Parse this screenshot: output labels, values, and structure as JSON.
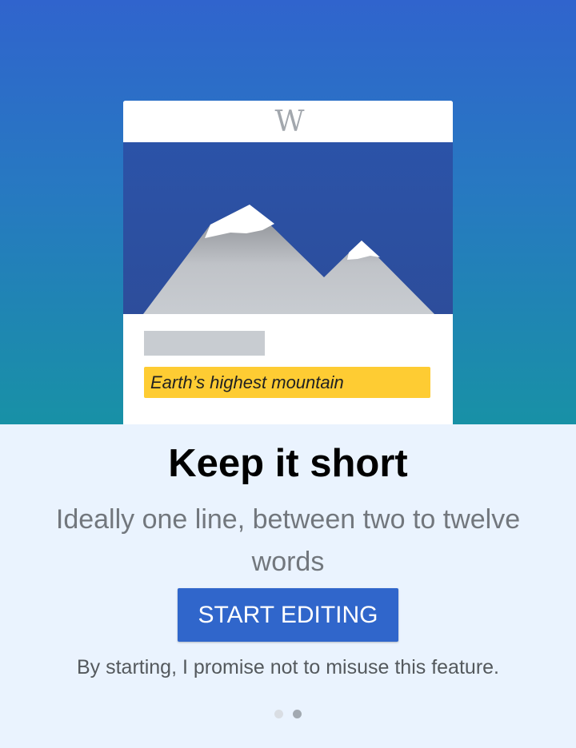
{
  "illustration": {
    "logo_text": "W",
    "article_description": "Earth’s highest mountain",
    "colors": {
      "sky_top": "#2b53a8",
      "sky_bottom": "#2d4d9b",
      "mountain_light": "#c8ccd1",
      "mountain_dark": "#84878c",
      "snow": "#ffffff",
      "highlight": "#fecc33"
    }
  },
  "onboarding": {
    "headline": "Keep it short",
    "subtext": "Ideally one line, between two to twelve words",
    "start_button": "START EDITING",
    "disclaimer": "By starting, I promise not to misuse this feature."
  },
  "pager": {
    "total_pages": 2,
    "current_page": 2
  },
  "colors": {
    "header_gradient_top": "#3064cd",
    "header_gradient_bottom": "#1891a6",
    "background": "#eaf3fe",
    "accent": "#3066cb"
  }
}
